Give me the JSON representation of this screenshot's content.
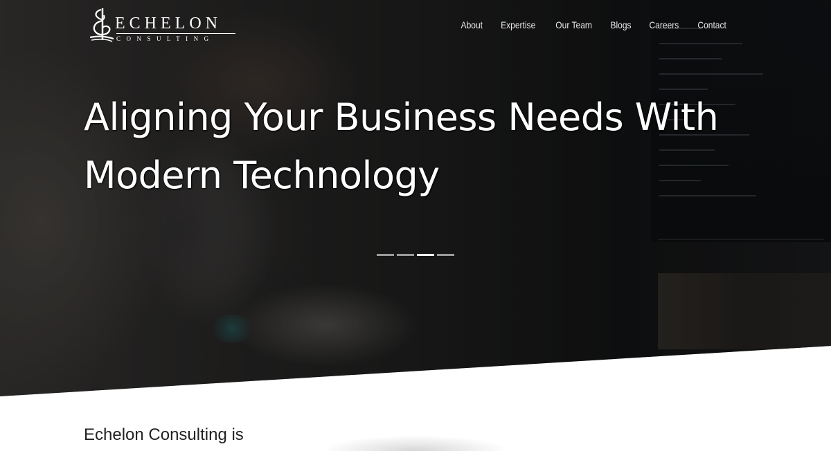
{
  "brand": {
    "name": "ECHELON",
    "tagline": "CONSULTING"
  },
  "nav": {
    "items": [
      {
        "label": "About"
      },
      {
        "label": "Expertise"
      },
      {
        "label": "Our Team"
      },
      {
        "label": "Blogs"
      },
      {
        "label": "Careers"
      },
      {
        "label": "Contact"
      }
    ]
  },
  "hero": {
    "headline_line1": "Aligning Your Business Needs With",
    "headline_line2": "Modern Technology",
    "slides": {
      "count": 4,
      "active_index": 2
    }
  },
  "intro": {
    "text": "Echelon Consulting is"
  },
  "colors": {
    "text_light": "#ffffff",
    "nav_text": "#e9e9e9",
    "body_text": "#222222",
    "background": "#ffffff"
  }
}
